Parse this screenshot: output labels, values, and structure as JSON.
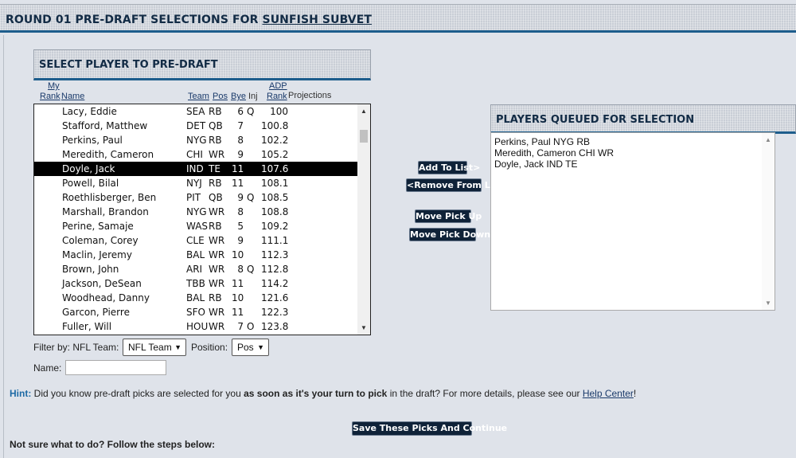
{
  "header": {
    "title_prefix": "ROUND 01 PRE-DRAFT SELECTIONS FOR ",
    "title_team": "SUNFISH SUBVET"
  },
  "select_panel": {
    "title": "SELECT PLAYER TO PRE-DRAFT",
    "columns": {
      "my_rank_top": "My",
      "my_rank_bottom": "Rank",
      "name": "Name",
      "team": "Team",
      "pos": "Pos",
      "bye": "Bye",
      "inj": "Inj",
      "adp_top": "ADP",
      "adp_bottom": "Rank",
      "projections": "Projections"
    },
    "players": [
      {
        "name": "Lacy, Eddie",
        "team": "SEA",
        "pos": "RB",
        "bye": "6",
        "inj": "Q",
        "adp": "100"
      },
      {
        "name": "Stafford, Matthew",
        "team": "DET",
        "pos": "QB",
        "bye": "7",
        "inj": "",
        "adp": "100.8"
      },
      {
        "name": "Perkins, Paul",
        "team": "NYG",
        "pos": "RB",
        "bye": "8",
        "inj": "",
        "adp": "102.2"
      },
      {
        "name": "Meredith, Cameron",
        "team": "CHI",
        "pos": "WR",
        "bye": "9",
        "inj": "",
        "adp": "105.2"
      },
      {
        "name": "Doyle, Jack",
        "team": "IND",
        "pos": "TE",
        "bye": "11",
        "inj": "",
        "adp": "107.6"
      },
      {
        "name": "Powell, Bilal",
        "team": "NYJ",
        "pos": "RB",
        "bye": "11",
        "inj": "",
        "adp": "108.1"
      },
      {
        "name": "Roethlisberger, Ben",
        "team": "PIT",
        "pos": "QB",
        "bye": "9",
        "inj": "Q",
        "adp": "108.5"
      },
      {
        "name": "Marshall, Brandon",
        "team": "NYG",
        "pos": "WR",
        "bye": "8",
        "inj": "",
        "adp": "108.8"
      },
      {
        "name": "Perine, Samaje",
        "team": "WAS",
        "pos": "RB",
        "bye": "5",
        "inj": "",
        "adp": "109.2"
      },
      {
        "name": "Coleman, Corey",
        "team": "CLE",
        "pos": "WR",
        "bye": "9",
        "inj": "",
        "adp": "111.1"
      },
      {
        "name": "Maclin, Jeremy",
        "team": "BAL",
        "pos": "WR",
        "bye": "10",
        "inj": "",
        "adp": "112.3"
      },
      {
        "name": "Brown, John",
        "team": "ARI",
        "pos": "WR",
        "bye": "8",
        "inj": "Q",
        "adp": "112.8"
      },
      {
        "name": "Jackson, DeSean",
        "team": "TBB",
        "pos": "WR",
        "bye": "11",
        "inj": "",
        "adp": "114.2"
      },
      {
        "name": "Woodhead, Danny",
        "team": "BAL",
        "pos": "RB",
        "bye": "10",
        "inj": "",
        "adp": "121.6"
      },
      {
        "name": "Garcon, Pierre",
        "team": "SFO",
        "pos": "WR",
        "bye": "11",
        "inj": "",
        "adp": "122.3"
      },
      {
        "name": "Fuller, Will",
        "team": "HOU",
        "pos": "WR",
        "bye": "7",
        "inj": "O",
        "adp": "123.8"
      }
    ],
    "selected_index": 4
  },
  "filters": {
    "filter_label": "Filter by: NFL Team:",
    "team_select": "NFL Team",
    "position_label": "Position:",
    "pos_select": "Pos",
    "name_label": "Name:",
    "name_value": ""
  },
  "buttons": {
    "add": "Add To List>",
    "remove": "<Remove From List",
    "up": "Move Pick Up",
    "down": "Move Pick Down",
    "save": "Save These Picks And Continue"
  },
  "queue_panel": {
    "title": "PLAYERS QUEUED FOR SELECTION",
    "items": [
      "Perkins, Paul NYG RB",
      "Meredith, Cameron CHI WR",
      "Doyle, Jack IND TE"
    ]
  },
  "hint": {
    "label": "Hint:",
    "part1": " Did you know pre-draft picks are selected for you ",
    "bold": "as soon as it's your turn to pick",
    "part2": " in the draft? For more details, please see our ",
    "link": "Help Center",
    "end": "!"
  },
  "steps": "Not sure what to do? Follow the steps below:"
}
